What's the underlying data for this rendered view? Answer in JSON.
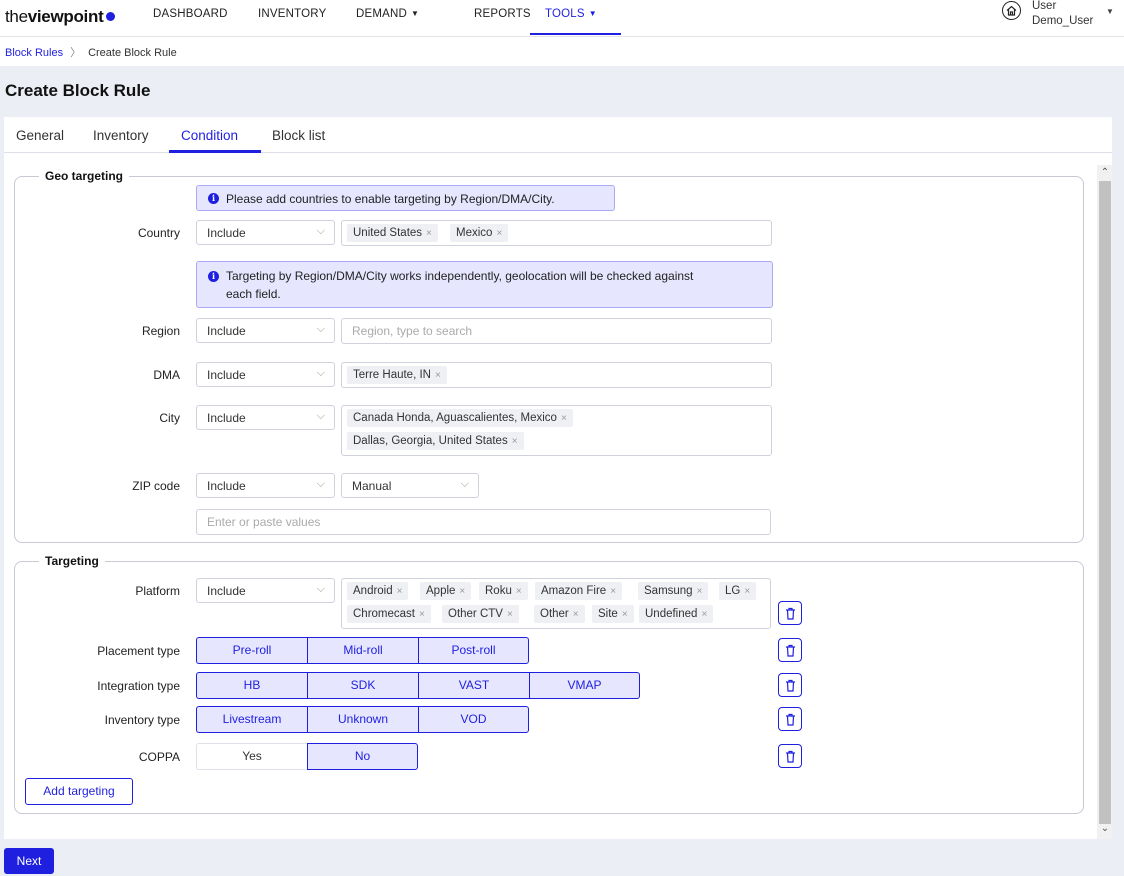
{
  "brand": {
    "prefix": "the",
    "name": "viewpoint",
    "accent": "#1f1fe0"
  },
  "nav": {
    "items": [
      {
        "label": "DASHBOARD"
      },
      {
        "label": "INVENTORY"
      },
      {
        "label": "DEMAND"
      },
      {
        "label": "REPORTS"
      },
      {
        "label": "TOOLS"
      }
    ],
    "active": "TOOLS"
  },
  "user": {
    "label": "User",
    "name": "Demo_User",
    "icon": "home-icon"
  },
  "breadcrumb": {
    "parent": "Block Rules",
    "current": "Create Block Rule"
  },
  "page": {
    "title": "Create Block Rule"
  },
  "tabs": {
    "items": [
      "General",
      "Inventory",
      "Condition",
      "Block list"
    ],
    "active": "Condition"
  },
  "geo": {
    "legend": "Geo targeting",
    "info_country": "Please add countries to enable targeting by Region/DMA/City.",
    "info_independent_line1": "Targeting by Region/DMA/City works independently, geolocation will be checked against",
    "info_independent_line2": "each field.",
    "country": {
      "label": "Country",
      "mode": "Include",
      "tags": [
        "United States",
        "Mexico"
      ]
    },
    "region": {
      "label": "Region",
      "mode": "Include",
      "placeholder": "Region, type to search"
    },
    "dma": {
      "label": "DMA",
      "mode": "Include",
      "tags": [
        "Terre Haute, IN"
      ]
    },
    "city": {
      "label": "City",
      "mode": "Include",
      "tags": [
        "Canada Honda, Aguascalientes, Mexico",
        "Dallas, Georgia, United States"
      ]
    },
    "zip": {
      "label": "ZIP code",
      "mode": "Include",
      "input_mode": "Manual",
      "placeholder": "Enter or paste values"
    }
  },
  "targeting": {
    "legend": "Targeting",
    "platform": {
      "label": "Platform",
      "mode": "Include",
      "tags": [
        "Android",
        "Apple",
        "Roku",
        "Amazon Fire",
        "Samsung",
        "LG",
        "Chromecast",
        "Other CTV",
        "Other",
        "Site",
        "Undefined"
      ]
    },
    "placement": {
      "label": "Placement type",
      "options": [
        "Pre-roll",
        "Mid-roll",
        "Post-roll"
      ]
    },
    "integration": {
      "label": "Integration type",
      "options": [
        "HB",
        "SDK",
        "VAST",
        "VMAP"
      ]
    },
    "inventory": {
      "label": "Inventory type",
      "options": [
        "Livestream",
        "Unknown",
        "VOD"
      ]
    },
    "coppa": {
      "label": "COPPA",
      "options": [
        "Yes",
        "No"
      ],
      "selected": "No"
    },
    "add_label": "Add targeting"
  },
  "footer": {
    "next_label": "Next"
  }
}
